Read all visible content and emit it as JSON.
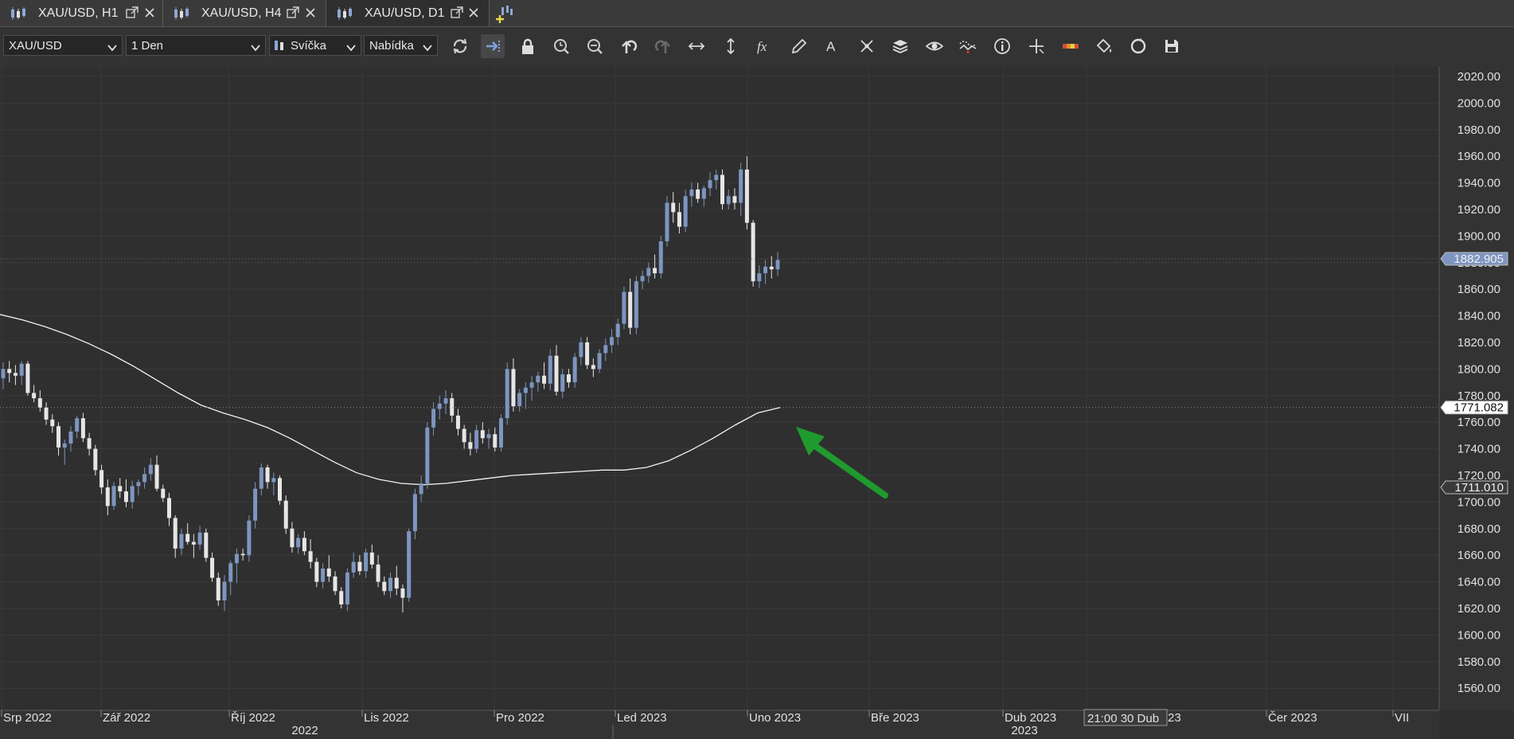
{
  "tabs": [
    {
      "label": "XAU/USD, H1"
    },
    {
      "label": "XAU/USD, H4"
    },
    {
      "label": "XAU/USD, D1",
      "active": true
    }
  ],
  "toolbar": {
    "symbol": "XAU/USD",
    "timeframe": "1 Den",
    "chart_type": "Svíčka",
    "price_side": "Nabídka",
    "icons": [
      "refresh-icon",
      "auto-scroll-icon",
      "lock-icon",
      "zoom-in-icon",
      "zoom-out-icon",
      "undo-icon",
      "redo-icon",
      "horizontal-arrows-icon",
      "vertical-arrows-icon",
      "fx-indicators-icon",
      "pencil-icon",
      "text-icon",
      "object-tree-icon",
      "layers-icon",
      "eye-icon",
      "pattern-icon",
      "info-icon",
      "crosshair-icon",
      "color-bar-icon",
      "paint-bucket-icon",
      "sync-icon",
      "save-icon"
    ]
  },
  "chart_data": {
    "type": "candlestick",
    "symbol": "XAU/USD",
    "timeframe": "D1",
    "y_ticks": [
      1560,
      1580,
      1600,
      1620,
      1640,
      1660,
      1680,
      1700,
      1720,
      1740,
      1760,
      1780,
      1800,
      1820,
      1840,
      1860,
      1880,
      1900,
      1920,
      1940,
      1960,
      1980,
      2000,
      2020
    ],
    "y_tick_labels": [
      "1560.00",
      "1580.00",
      "1600.00",
      "1620.00",
      "1640.00",
      "1660.00",
      "1680.00",
      "1700.00",
      "1720.00",
      "1740.00",
      "1760.00",
      "1780.00",
      "1800.00",
      "1820.00",
      "1840.00",
      "1860.00",
      "1880.00",
      "1900.00",
      "1920.00",
      "1940.00",
      "1960.00",
      "1980.00",
      "2000.00",
      "2020.00"
    ],
    "ylim": [
      1545,
      2030
    ],
    "x_labels": [
      "Srp 2022",
      "Zář 2022",
      "Říj 2022",
      "Lis 2022",
      "Pro 2022",
      "Led 2023",
      "Uno 2023",
      "Bře 2023",
      "Dub 2023",
      "23",
      "Čer 2023",
      "VII"
    ],
    "year_labels": [
      "2022",
      "2023"
    ],
    "crosshair_time_label": "21:00 30 Dub",
    "price_markers": [
      {
        "value": 1882.905,
        "label": "1882.905",
        "color": "#7d95c0",
        "kind": "current-price"
      },
      {
        "value": 1771.082,
        "label": "1771.082",
        "color": "#ffffff",
        "kind": "moving-average"
      },
      {
        "value": 1711.01,
        "label": "1711.010",
        "color": "#3a3a3a",
        "kind": "level"
      }
    ],
    "bull_color": "#7d95c0",
    "bear_color": "#e6e6e6",
    "ma_color": "#f2f2f2",
    "arrow_color": "#1f9a2e",
    "candles_ohlc": [
      [
        1793,
        1805,
        1785,
        1800
      ],
      [
        1800,
        1806,
        1790,
        1797
      ],
      [
        1797,
        1803,
        1788,
        1795
      ],
      [
        1795,
        1806,
        1788,
        1804
      ],
      [
        1804,
        1806,
        1780,
        1782
      ],
      [
        1782,
        1788,
        1775,
        1778
      ],
      [
        1778,
        1784,
        1768,
        1771
      ],
      [
        1771,
        1775,
        1758,
        1762
      ],
      [
        1762,
        1766,
        1752,
        1757
      ],
      [
        1757,
        1760,
        1735,
        1741
      ],
      [
        1741,
        1747,
        1728,
        1744
      ],
      [
        1744,
        1757,
        1738,
        1753
      ],
      [
        1753,
        1765,
        1748,
        1763
      ],
      [
        1763,
        1767,
        1745,
        1748
      ],
      [
        1748,
        1752,
        1735,
        1740
      ],
      [
        1740,
        1743,
        1720,
        1724
      ],
      [
        1724,
        1728,
        1706,
        1711
      ],
      [
        1711,
        1717,
        1690,
        1697
      ],
      [
        1697,
        1715,
        1694,
        1712
      ],
      [
        1712,
        1718,
        1703,
        1708
      ],
      [
        1708,
        1717,
        1696,
        1700
      ],
      [
        1700,
        1716,
        1695,
        1712
      ],
      [
        1712,
        1717,
        1705,
        1715
      ],
      [
        1715,
        1726,
        1710,
        1721
      ],
      [
        1721,
        1733,
        1716,
        1728
      ],
      [
        1728,
        1735,
        1708,
        1710
      ],
      [
        1710,
        1713,
        1700,
        1703
      ],
      [
        1703,
        1707,
        1682,
        1688
      ],
      [
        1688,
        1690,
        1658,
        1665
      ],
      [
        1665,
        1680,
        1660,
        1676
      ],
      [
        1676,
        1684,
        1668,
        1670
      ],
      [
        1670,
        1676,
        1658,
        1668
      ],
      [
        1668,
        1682,
        1664,
        1677
      ],
      [
        1677,
        1680,
        1655,
        1658
      ],
      [
        1658,
        1662,
        1640,
        1643
      ],
      [
        1643,
        1647,
        1622,
        1626
      ],
      [
        1626,
        1645,
        1618,
        1640
      ],
      [
        1640,
        1656,
        1630,
        1654
      ],
      [
        1654,
        1665,
        1639,
        1661
      ],
      [
        1661,
        1665,
        1656,
        1660
      ],
      [
        1660,
        1690,
        1655,
        1686
      ],
      [
        1686,
        1715,
        1680,
        1710
      ],
      [
        1710,
        1729,
        1705,
        1726
      ],
      [
        1726,
        1728,
        1710,
        1715
      ],
      [
        1715,
        1722,
        1705,
        1718
      ],
      [
        1718,
        1720,
        1698,
        1701
      ],
      [
        1701,
        1705,
        1676,
        1680
      ],
      [
        1680,
        1685,
        1662,
        1666
      ],
      [
        1666,
        1676,
        1661,
        1673
      ],
      [
        1673,
        1678,
        1660,
        1663
      ],
      [
        1663,
        1672,
        1650,
        1655
      ],
      [
        1655,
        1658,
        1636,
        1640
      ],
      [
        1640,
        1654,
        1635,
        1650
      ],
      [
        1650,
        1660,
        1640,
        1644
      ],
      [
        1644,
        1648,
        1630,
        1633
      ],
      [
        1633,
        1636,
        1620,
        1623
      ],
      [
        1623,
        1650,
        1618,
        1647
      ],
      [
        1647,
        1662,
        1643,
        1655
      ],
      [
        1655,
        1660,
        1645,
        1648
      ],
      [
        1648,
        1665,
        1643,
        1662
      ],
      [
        1662,
        1668,
        1650,
        1653
      ],
      [
        1653,
        1660,
        1636,
        1640
      ],
      [
        1640,
        1644,
        1630,
        1633
      ],
      [
        1633,
        1647,
        1628,
        1643
      ],
      [
        1643,
        1652,
        1630,
        1635
      ],
      [
        1635,
        1638,
        1617,
        1628
      ],
      [
        1628,
        1680,
        1625,
        1678
      ],
      [
        1678,
        1710,
        1672,
        1706
      ],
      [
        1706,
        1720,
        1700,
        1714
      ],
      [
        1714,
        1760,
        1710,
        1756
      ],
      [
        1756,
        1775,
        1750,
        1770
      ],
      [
        1770,
        1780,
        1762,
        1774
      ],
      [
        1774,
        1784,
        1766,
        1778
      ],
      [
        1778,
        1782,
        1760,
        1765
      ],
      [
        1765,
        1770,
        1750,
        1755
      ],
      [
        1755,
        1758,
        1740,
        1745
      ],
      [
        1745,
        1752,
        1735,
        1740
      ],
      [
        1740,
        1758,
        1737,
        1754
      ],
      [
        1754,
        1760,
        1744,
        1748
      ],
      [
        1748,
        1755,
        1740,
        1751
      ],
      [
        1751,
        1756,
        1738,
        1741
      ],
      [
        1741,
        1766,
        1738,
        1763
      ],
      [
        1763,
        1805,
        1758,
        1800
      ],
      [
        1800,
        1808,
        1768,
        1772
      ],
      [
        1772,
        1785,
        1768,
        1782
      ],
      [
        1782,
        1790,
        1770,
        1786
      ],
      [
        1786,
        1795,
        1776,
        1790
      ],
      [
        1790,
        1798,
        1783,
        1795
      ],
      [
        1795,
        1805,
        1785,
        1789
      ],
      [
        1789,
        1815,
        1784,
        1810
      ],
      [
        1810,
        1818,
        1780,
        1783
      ],
      [
        1783,
        1800,
        1778,
        1796
      ],
      [
        1796,
        1800,
        1786,
        1790
      ],
      [
        1790,
        1812,
        1786,
        1809
      ],
      [
        1809,
        1824,
        1803,
        1820
      ],
      [
        1820,
        1824,
        1800,
        1803
      ],
      [
        1803,
        1808,
        1794,
        1800
      ],
      [
        1800,
        1815,
        1797,
        1812
      ],
      [
        1812,
        1823,
        1806,
        1818
      ],
      [
        1818,
        1830,
        1812,
        1824
      ],
      [
        1824,
        1838,
        1818,
        1834
      ],
      [
        1834,
        1862,
        1830,
        1858
      ],
      [
        1858,
        1868,
        1826,
        1831
      ],
      [
        1831,
        1870,
        1826,
        1866
      ],
      [
        1866,
        1874,
        1860,
        1870
      ],
      [
        1870,
        1880,
        1865,
        1876
      ],
      [
        1876,
        1886,
        1868,
        1872
      ],
      [
        1872,
        1900,
        1868,
        1896
      ],
      [
        1896,
        1930,
        1892,
        1925
      ],
      [
        1925,
        1933,
        1910,
        1918
      ],
      [
        1918,
        1925,
        1902,
        1907
      ],
      [
        1907,
        1935,
        1903,
        1930
      ],
      [
        1930,
        1940,
        1922,
        1935
      ],
      [
        1935,
        1940,
        1925,
        1928
      ],
      [
        1928,
        1938,
        1922,
        1936
      ],
      [
        1936,
        1948,
        1930,
        1942
      ],
      [
        1942,
        1950,
        1935,
        1946
      ],
      [
        1946,
        1950,
        1920,
        1924
      ],
      [
        1924,
        1935,
        1920,
        1930
      ],
      [
        1930,
        1936,
        1920,
        1925
      ],
      [
        1925,
        1955,
        1915,
        1950
      ],
      [
        1950,
        1960,
        1905,
        1910
      ],
      [
        1910,
        1912,
        1862,
        1866
      ],
      [
        1866,
        1878,
        1861,
        1872
      ],
      [
        1872,
        1882,
        1864,
        1877
      ],
      [
        1877,
        1885,
        1868,
        1875
      ],
      [
        1875,
        1888,
        1870,
        1882
      ]
    ],
    "ma_series": [
      1841,
      1837,
      1832,
      1826,
      1819,
      1811,
      1802,
      1792,
      1782,
      1773,
      1767,
      1762,
      1756,
      1748,
      1739,
      1730,
      1722,
      1717,
      1714,
      1713,
      1714,
      1716,
      1718,
      1720,
      1721,
      1722,
      1723,
      1724,
      1724,
      1726,
      1731,
      1739,
      1748,
      1758,
      1767,
      1771.082
    ]
  }
}
